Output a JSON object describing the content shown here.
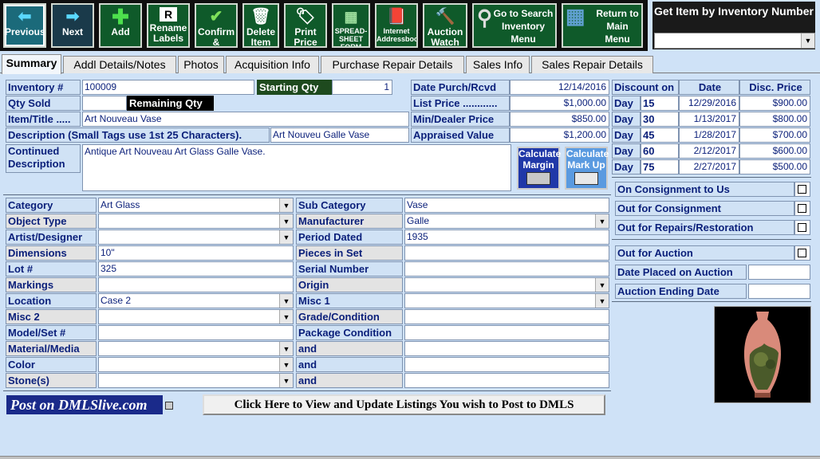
{
  "toolbar": {
    "buttons": [
      "Previous",
      "Next",
      "Add",
      "Rename Labels",
      "Confirm & Update",
      "Delete Item",
      "Print Price Tags",
      "SPREAD-SHEET FORM",
      "Internet Addressbook",
      "Auction Watch",
      "Go to Search Inventory Menu",
      "Return to Main Menu"
    ]
  },
  "getitem": {
    "title": "Get Item by Inventory Number",
    "value": ""
  },
  "tabs": [
    "Summary",
    "Addl Details/Notes",
    "Photos",
    "Acquisition Info",
    "Purchase Repair Details",
    "Sales Info",
    "Sales Repair Details"
  ],
  "summary": {
    "inventory_label": "Inventory #",
    "inventory": "100009",
    "starting_qty_label": "Starting Qty",
    "starting_qty": "1",
    "qty_sold_label": "Qty Sold",
    "qty_sold": "",
    "remaining_qty_label": "Remaining Qty",
    "item_title_label": "Item/Title .....",
    "item_title": "Art Nouveau Vase",
    "description_label": "Description (Small Tags use 1st 25 Characters).",
    "description": "Art Nouveu Galle Vase",
    "continued_label": "Continued Description",
    "continued": "Antique Art Nouveau Art Glass Galle Vase.",
    "date_purch_label": "Date Purch/Rcvd",
    "date_purch": "12/14/2016",
    "list_price_label": "List  Price ............",
    "list_price": "$1,000.00",
    "min_dealer_label": "Min/Dealer Price",
    "min_dealer": "$850.00",
    "appraised_label": "Appraised Value",
    "appraised": "$1,200.00",
    "calc_margin": "Calculate Margin",
    "calc_markup": "Calculate Mark Up"
  },
  "discount": {
    "headers": [
      "Discount on",
      "Date",
      "Disc. Price"
    ],
    "rows": [
      {
        "day": "Day",
        "n": "15",
        "date": "12/29/2016",
        "price": "$900.00"
      },
      {
        "day": "Day",
        "n": "30",
        "date": "1/13/2017",
        "price": "$800.00"
      },
      {
        "day": "Day",
        "n": "45",
        "date": "1/28/2017",
        "price": "$700.00"
      },
      {
        "day": "Day",
        "n": "60",
        "date": "2/12/2017",
        "price": "$600.00"
      },
      {
        "day": "Day",
        "n": "75",
        "date": "2/27/2017",
        "price": "$500.00"
      }
    ]
  },
  "flags": {
    "consign_to_us": "On Consignment to Us",
    "out_consign": "Out for Consignment",
    "out_repairs": "Out for Repairs/Restoration",
    "out_auction": "Out for Auction",
    "date_placed": "Date Placed on Auction",
    "auction_end": "Auction Ending Date"
  },
  "left": {
    "rows": [
      {
        "label": "Category",
        "value": "Art Glass"
      },
      {
        "label": "Object Type",
        "value": ""
      },
      {
        "label": "Artist/Designer",
        "value": ""
      },
      {
        "label": "Dimensions",
        "value": "10\""
      },
      {
        "label": "Lot #",
        "value": "325"
      },
      {
        "label": "Markings",
        "value": ""
      },
      {
        "label": "Location",
        "value": "Case 2"
      },
      {
        "label": "Misc 2",
        "value": ""
      },
      {
        "label": "Model/Set #",
        "value": ""
      },
      {
        "label": "Material/Media",
        "value": ""
      },
      {
        "label": "Color",
        "value": ""
      },
      {
        "label": "Stone(s)",
        "value": ""
      }
    ]
  },
  "right": {
    "rows": [
      {
        "label": "Sub Category",
        "value": "Vase"
      },
      {
        "label": "Manufacturer",
        "value": "Galle"
      },
      {
        "label": "Period Dated",
        "value": "1935"
      },
      {
        "label": "Pieces in Set",
        "value": ""
      },
      {
        "label": "Serial Number",
        "value": ""
      },
      {
        "label": "Origin",
        "value": ""
      },
      {
        "label": "Misc 1",
        "value": ""
      },
      {
        "label": "Grade/Condition",
        "value": ""
      },
      {
        "label": "Package Condition",
        "value": ""
      },
      {
        "label": "and",
        "value": ""
      },
      {
        "label": "and",
        "value": ""
      },
      {
        "label": "and",
        "value": ""
      }
    ]
  },
  "footer": {
    "dmls": "Post on DMLSlive.com",
    "post_button": "Click Here to View and Update Listings You wish to Post to DMLS"
  }
}
